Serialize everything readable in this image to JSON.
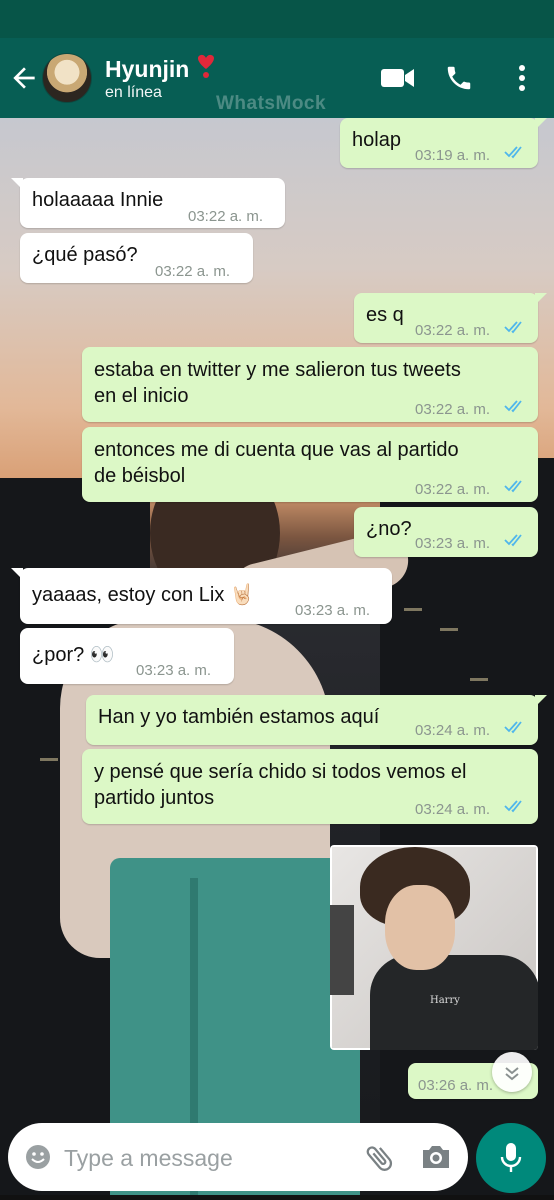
{
  "header": {
    "contact_name": "Hyunjin",
    "status": "en línea",
    "watermark": "WhatsMock",
    "heart_emoji": "❣️",
    "icons": [
      "back-arrow-icon",
      "video-call-icon",
      "phone-call-icon",
      "more-options-icon"
    ],
    "colors": {
      "header": "#075e54",
      "statusbar": "#075548"
    }
  },
  "messages": [
    {
      "dir": "out",
      "text": "holap",
      "time": "03:19 a. m.",
      "read": true
    },
    {
      "dir": "in",
      "text": "holaaaaa Innie",
      "time": "03:22 a. m."
    },
    {
      "dir": "in",
      "text": "¿qué pasó?",
      "time": "03:22 a. m."
    },
    {
      "dir": "out",
      "text": "es q",
      "time": "03:22 a. m.",
      "read": true
    },
    {
      "dir": "out",
      "lines": [
        "estaba en twitter y me salieron tus tweets",
        "en el inicio"
      ],
      "time": "03:22 a. m.",
      "read": true
    },
    {
      "dir": "out",
      "lines": [
        "entonces me di cuenta que vas al partido",
        "de béisbol"
      ],
      "time": "03:22 a. m.",
      "read": true
    },
    {
      "dir": "out",
      "text": "¿no?",
      "time": "03:23 a. m.",
      "read": true
    },
    {
      "dir": "in",
      "text": "yaaaas, estoy con Lix 🤘🏻",
      "time": "03:23 a. m."
    },
    {
      "dir": "in",
      "text": "¿por? 👀",
      "time": "03:23 a. m."
    },
    {
      "dir": "out",
      "text": "Han y yo también estamos aquí",
      "time": "03:24 a. m.",
      "read": true
    },
    {
      "dir": "out",
      "lines": [
        "y pensé que sería chido si todos vemos el",
        "partido juntos"
      ],
      "time": "03:24 a. m.",
      "read": true
    },
    {
      "dir": "out",
      "type": "image",
      "image_desc": "photo",
      "time": "03:26 a. m."
    }
  ],
  "composer": {
    "placeholder": "Type a message",
    "icons": [
      "emoji-icon",
      "attach-icon",
      "camera-icon",
      "mic-icon",
      "scroll-down-icon"
    ]
  },
  "colors": {
    "outgoing": "#dcf8c6",
    "incoming": "#ffffff",
    "tick_read": "#4fb6ec",
    "mic": "#00897b"
  }
}
